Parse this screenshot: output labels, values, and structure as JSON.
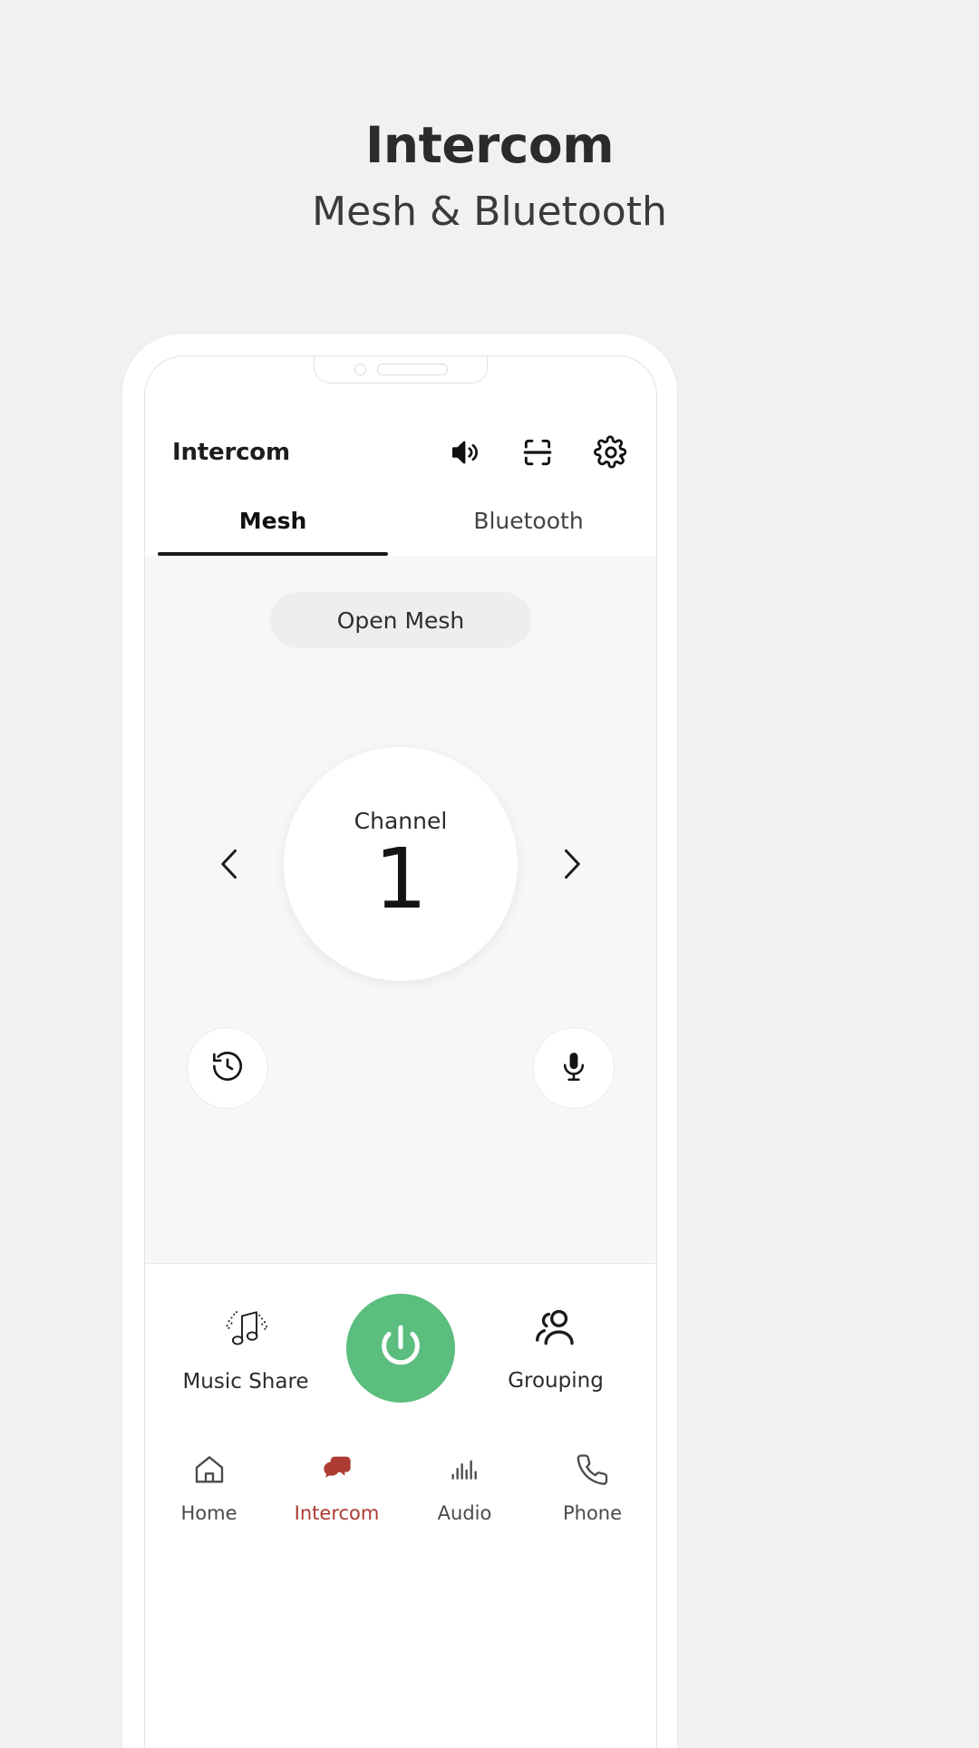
{
  "page": {
    "title": "Intercom",
    "subtitle": "Mesh & Bluetooth",
    "background": "#f1f1f1"
  },
  "app": {
    "header": {
      "title": "Intercom",
      "icons": [
        {
          "name": "speaker-icon",
          "label": "Speaker"
        },
        {
          "name": "scan-icon",
          "label": "Scan"
        },
        {
          "name": "gear-icon",
          "label": "Settings"
        }
      ]
    },
    "tabs": [
      {
        "label": "Mesh",
        "active": true
      },
      {
        "label": "Bluetooth",
        "active": false
      }
    ],
    "mesh": {
      "mode_pill": "Open Mesh",
      "channel_label": "Channel",
      "channel_value": "1",
      "prev_icon": "chevron-left-icon",
      "next_icon": "chevron-right-icon",
      "history_icon": "history-icon",
      "mic_icon": "microphone-icon"
    },
    "actions": {
      "left": {
        "label": "Music Share",
        "icon": "music-note-icon"
      },
      "power": {
        "icon": "power-icon",
        "color": "#5bbd7e"
      },
      "right": {
        "label": "Grouping",
        "icon": "people-icon"
      }
    },
    "bottom_nav": {
      "active_color": "#ac3b32",
      "items": [
        {
          "label": "Home",
          "icon": "home-icon",
          "active": false
        },
        {
          "label": "Intercom",
          "icon": "chat-bubbles-icon",
          "active": true
        },
        {
          "label": "Audio",
          "icon": "equalizer-icon",
          "active": false
        },
        {
          "label": "Phone",
          "icon": "phone-icon",
          "active": false
        }
      ]
    }
  }
}
